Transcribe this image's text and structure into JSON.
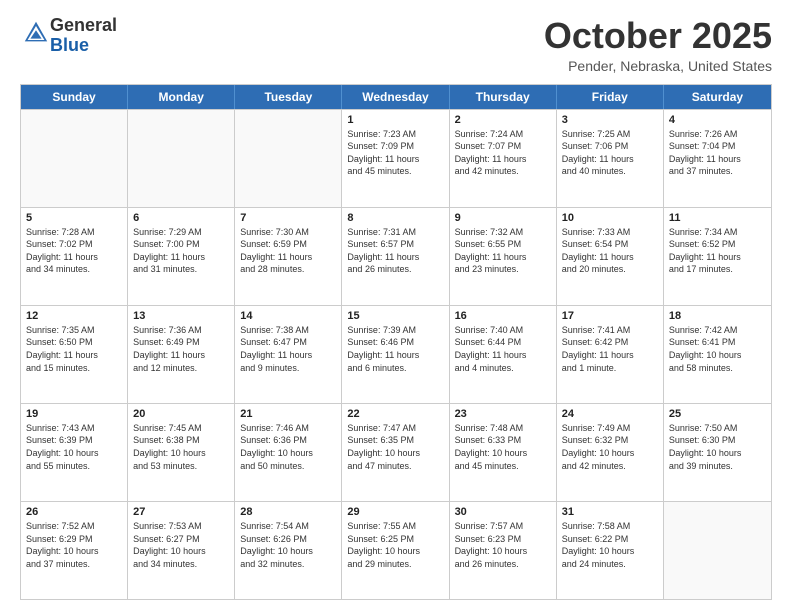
{
  "logo": {
    "general": "General",
    "blue": "Blue"
  },
  "title": "October 2025",
  "location": "Pender, Nebraska, United States",
  "days_of_week": [
    "Sunday",
    "Monday",
    "Tuesday",
    "Wednesday",
    "Thursday",
    "Friday",
    "Saturday"
  ],
  "weeks": [
    [
      {
        "num": "",
        "info": "",
        "empty": true
      },
      {
        "num": "",
        "info": "",
        "empty": true
      },
      {
        "num": "",
        "info": "",
        "empty": true
      },
      {
        "num": "1",
        "info": "Sunrise: 7:23 AM\nSunset: 7:09 PM\nDaylight: 11 hours\nand 45 minutes.",
        "empty": false
      },
      {
        "num": "2",
        "info": "Sunrise: 7:24 AM\nSunset: 7:07 PM\nDaylight: 11 hours\nand 42 minutes.",
        "empty": false
      },
      {
        "num": "3",
        "info": "Sunrise: 7:25 AM\nSunset: 7:06 PM\nDaylight: 11 hours\nand 40 minutes.",
        "empty": false
      },
      {
        "num": "4",
        "info": "Sunrise: 7:26 AM\nSunset: 7:04 PM\nDaylight: 11 hours\nand 37 minutes.",
        "empty": false
      }
    ],
    [
      {
        "num": "5",
        "info": "Sunrise: 7:28 AM\nSunset: 7:02 PM\nDaylight: 11 hours\nand 34 minutes.",
        "empty": false
      },
      {
        "num": "6",
        "info": "Sunrise: 7:29 AM\nSunset: 7:00 PM\nDaylight: 11 hours\nand 31 minutes.",
        "empty": false
      },
      {
        "num": "7",
        "info": "Sunrise: 7:30 AM\nSunset: 6:59 PM\nDaylight: 11 hours\nand 28 minutes.",
        "empty": false
      },
      {
        "num": "8",
        "info": "Sunrise: 7:31 AM\nSunset: 6:57 PM\nDaylight: 11 hours\nand 26 minutes.",
        "empty": false
      },
      {
        "num": "9",
        "info": "Sunrise: 7:32 AM\nSunset: 6:55 PM\nDaylight: 11 hours\nand 23 minutes.",
        "empty": false
      },
      {
        "num": "10",
        "info": "Sunrise: 7:33 AM\nSunset: 6:54 PM\nDaylight: 11 hours\nand 20 minutes.",
        "empty": false
      },
      {
        "num": "11",
        "info": "Sunrise: 7:34 AM\nSunset: 6:52 PM\nDaylight: 11 hours\nand 17 minutes.",
        "empty": false
      }
    ],
    [
      {
        "num": "12",
        "info": "Sunrise: 7:35 AM\nSunset: 6:50 PM\nDaylight: 11 hours\nand 15 minutes.",
        "empty": false
      },
      {
        "num": "13",
        "info": "Sunrise: 7:36 AM\nSunset: 6:49 PM\nDaylight: 11 hours\nand 12 minutes.",
        "empty": false
      },
      {
        "num": "14",
        "info": "Sunrise: 7:38 AM\nSunset: 6:47 PM\nDaylight: 11 hours\nand 9 minutes.",
        "empty": false
      },
      {
        "num": "15",
        "info": "Sunrise: 7:39 AM\nSunset: 6:46 PM\nDaylight: 11 hours\nand 6 minutes.",
        "empty": false
      },
      {
        "num": "16",
        "info": "Sunrise: 7:40 AM\nSunset: 6:44 PM\nDaylight: 11 hours\nand 4 minutes.",
        "empty": false
      },
      {
        "num": "17",
        "info": "Sunrise: 7:41 AM\nSunset: 6:42 PM\nDaylight: 11 hours\nand 1 minute.",
        "empty": false
      },
      {
        "num": "18",
        "info": "Sunrise: 7:42 AM\nSunset: 6:41 PM\nDaylight: 10 hours\nand 58 minutes.",
        "empty": false
      }
    ],
    [
      {
        "num": "19",
        "info": "Sunrise: 7:43 AM\nSunset: 6:39 PM\nDaylight: 10 hours\nand 55 minutes.",
        "empty": false
      },
      {
        "num": "20",
        "info": "Sunrise: 7:45 AM\nSunset: 6:38 PM\nDaylight: 10 hours\nand 53 minutes.",
        "empty": false
      },
      {
        "num": "21",
        "info": "Sunrise: 7:46 AM\nSunset: 6:36 PM\nDaylight: 10 hours\nand 50 minutes.",
        "empty": false
      },
      {
        "num": "22",
        "info": "Sunrise: 7:47 AM\nSunset: 6:35 PM\nDaylight: 10 hours\nand 47 minutes.",
        "empty": false
      },
      {
        "num": "23",
        "info": "Sunrise: 7:48 AM\nSunset: 6:33 PM\nDaylight: 10 hours\nand 45 minutes.",
        "empty": false
      },
      {
        "num": "24",
        "info": "Sunrise: 7:49 AM\nSunset: 6:32 PM\nDaylight: 10 hours\nand 42 minutes.",
        "empty": false
      },
      {
        "num": "25",
        "info": "Sunrise: 7:50 AM\nSunset: 6:30 PM\nDaylight: 10 hours\nand 39 minutes.",
        "empty": false
      }
    ],
    [
      {
        "num": "26",
        "info": "Sunrise: 7:52 AM\nSunset: 6:29 PM\nDaylight: 10 hours\nand 37 minutes.",
        "empty": false
      },
      {
        "num": "27",
        "info": "Sunrise: 7:53 AM\nSunset: 6:27 PM\nDaylight: 10 hours\nand 34 minutes.",
        "empty": false
      },
      {
        "num": "28",
        "info": "Sunrise: 7:54 AM\nSunset: 6:26 PM\nDaylight: 10 hours\nand 32 minutes.",
        "empty": false
      },
      {
        "num": "29",
        "info": "Sunrise: 7:55 AM\nSunset: 6:25 PM\nDaylight: 10 hours\nand 29 minutes.",
        "empty": false
      },
      {
        "num": "30",
        "info": "Sunrise: 7:57 AM\nSunset: 6:23 PM\nDaylight: 10 hours\nand 26 minutes.",
        "empty": false
      },
      {
        "num": "31",
        "info": "Sunrise: 7:58 AM\nSunset: 6:22 PM\nDaylight: 10 hours\nand 24 minutes.",
        "empty": false
      },
      {
        "num": "",
        "info": "",
        "empty": true
      }
    ]
  ]
}
